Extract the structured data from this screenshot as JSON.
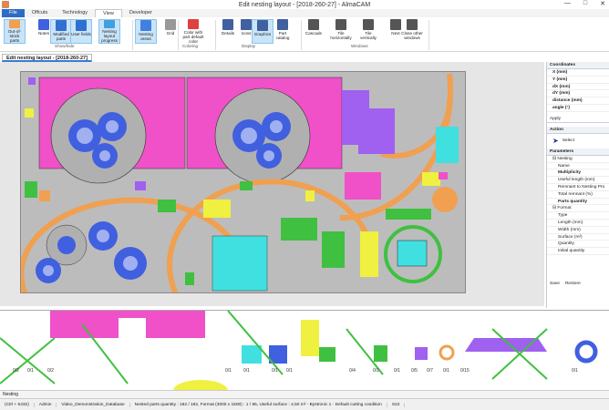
{
  "title": "Edit nesting layout - [2018-260-27] - AlmaCAM",
  "window_controls": [
    "—",
    "□",
    "✕"
  ],
  "tabs": [
    "File",
    "Offcuts",
    "Technology",
    "View",
    "Developer"
  ],
  "active_tab": "View",
  "ribbon": {
    "buttons": [
      {
        "label": "Out-of-stock parts",
        "sel": true
      },
      {
        "label": "Notes",
        "sel": false
      },
      {
        "label": "Modified parts",
        "sel": true
      },
      {
        "label": "User fields",
        "sel": true
      },
      {
        "label": "Nesting layout progress",
        "sel": true
      },
      {
        "label": "Nesting areas",
        "sel": true
      },
      {
        "label": "Grid",
        "sel": false
      },
      {
        "label": "Color with part default color",
        "sel": false
      },
      {
        "label": "Details",
        "sel": false
      },
      {
        "label": "Icons",
        "sel": false
      },
      {
        "label": "Graphics",
        "sel": true
      },
      {
        "label": "Part catalog",
        "sel": false
      },
      {
        "label": "Cascade",
        "sel": false
      },
      {
        "label": "Tile horizontally",
        "sel": false
      },
      {
        "label": "Tile vertically",
        "sel": false
      },
      {
        "label": "Next",
        "sel": false
      },
      {
        "label": "Close other windows",
        "sel": false
      }
    ],
    "groups": [
      "Show/hide",
      "Coloring",
      "Display",
      "Windows"
    ]
  },
  "doc_tab": "Edit nesting layout - [2018-260-27]",
  "right_panel": {
    "coordinates_header": "Coordinates",
    "coordinates": [
      "X (mm)",
      "Y (mm)",
      "dX (mm)",
      "dY (mm)",
      "distance (mm)",
      "angle (°)"
    ],
    "apply": "Apply",
    "action_header": "Action",
    "action_select": "Select",
    "parameters_header": "Parameters",
    "nesting_group": "Nesting",
    "nesting_params": [
      "Name",
      "Multiplicity",
      "Useful length (mm)",
      "Remnant to Nesting Pro",
      "Total remnant (%)",
      "Parts quantity"
    ],
    "format_group": "Format",
    "format_params": [
      "Type",
      "Length (mm)",
      "Width (mm)",
      "Surface (m²)",
      "Quantity",
      "Initial quantity"
    ],
    "save": "Save",
    "restore": "Restore"
  },
  "bottom_tab": "Nesting",
  "quantities": [
    "0/2",
    "0/1",
    "0/2",
    "0/1",
    "0/1",
    "0/1",
    "0/1",
    "0/4",
    "0/1",
    "0/1",
    "0/5",
    "0/7",
    "0/1",
    "0/15",
    "0/1"
  ],
  "status": [
    "(Ctrl + 5432)",
    "Admin",
    "Video_Demonstration_Database",
    "Nested parts quantity : 182 / 182, Format (3000 x 1500) : 1 / 85, Useful surface : 4,50 m² - Bystronic 1 - Default cutting condition",
    "S22"
  ],
  "colors": {
    "magenta": "#f050c8",
    "orange": "#f0a050",
    "blue": "#4060e0",
    "green": "#40c040",
    "yellow": "#f0f040",
    "purple": "#a060f0",
    "cyan": "#40e0e0",
    "selection": "#c8e4f8"
  }
}
